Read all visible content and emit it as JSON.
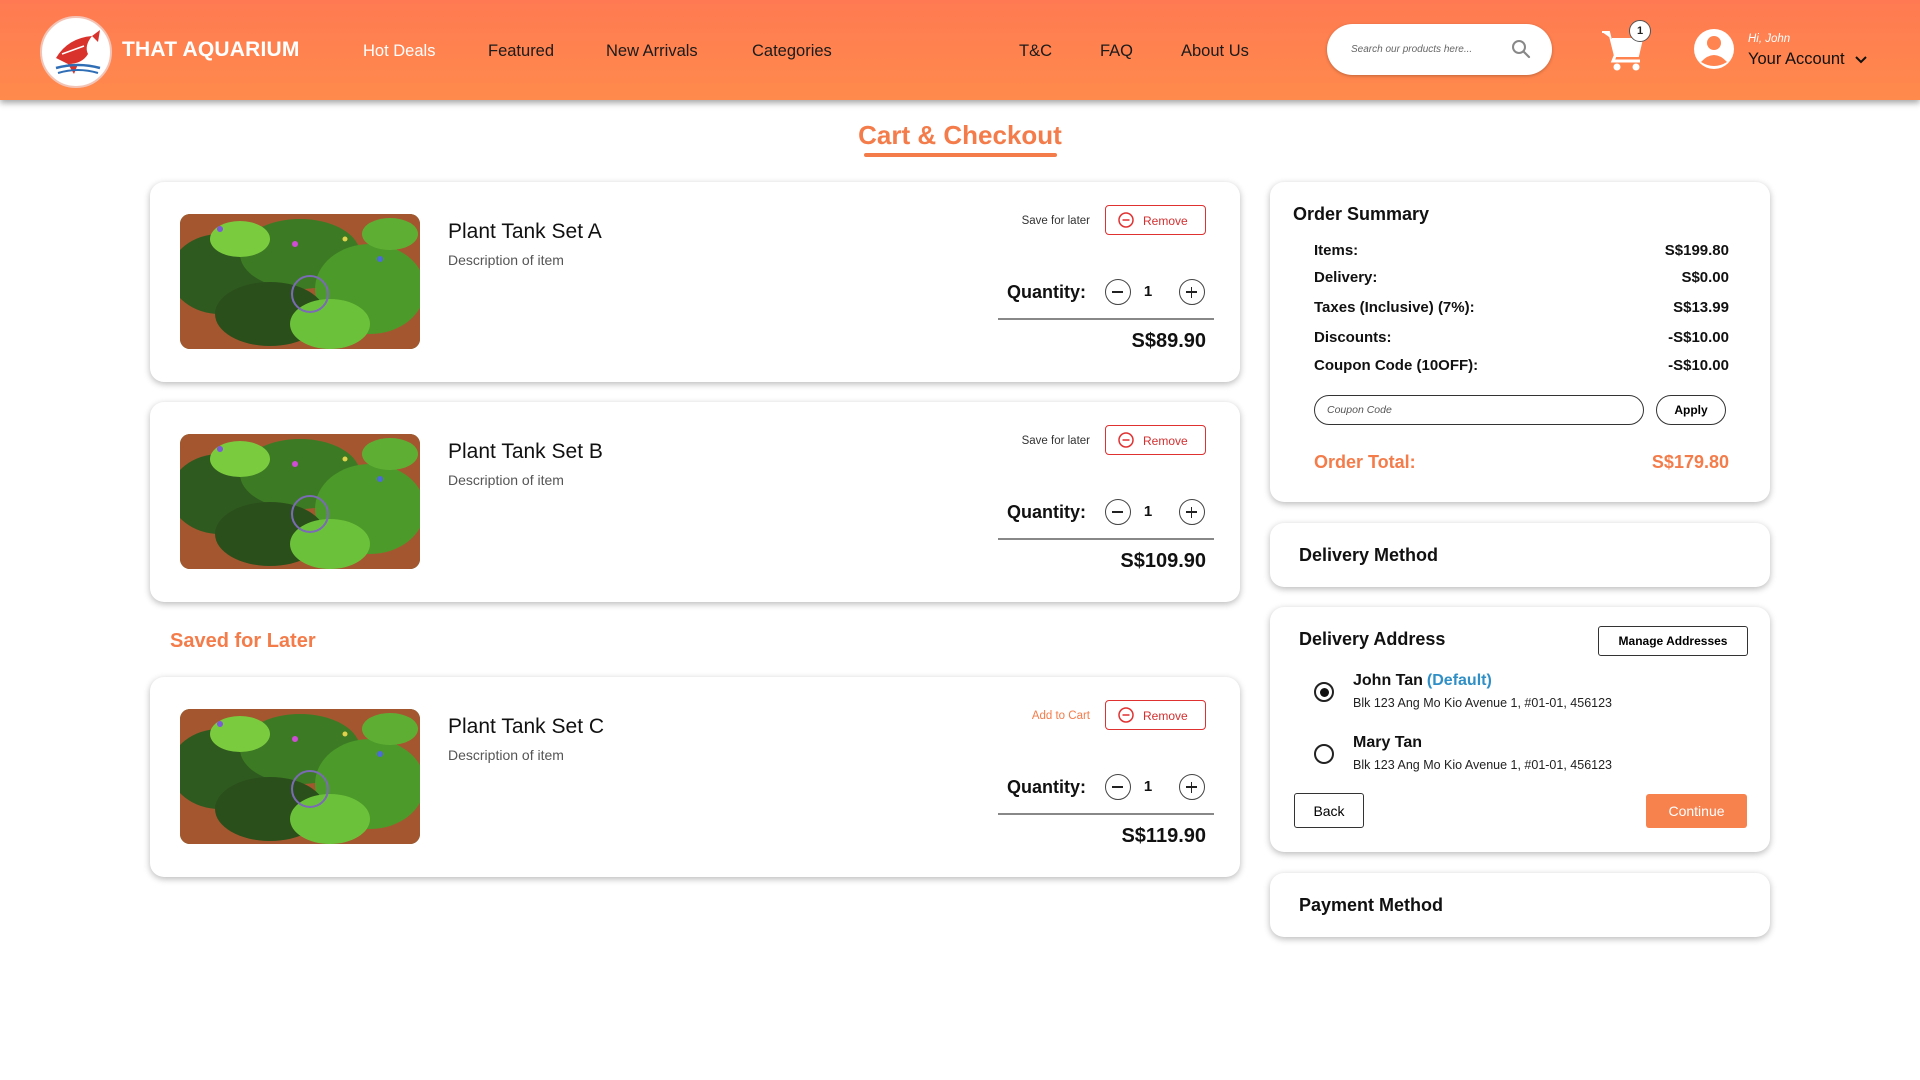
{
  "colors": {
    "brand_orange": "#ff7a52",
    "accent_orange": "#f47c4a",
    "remove_red": "#e03131",
    "default_blue": "#2f8fc6"
  },
  "header": {
    "brand": "THAT AQUARIUM",
    "logo_icon": "angelfish-logo-icon",
    "nav": [
      "Hot Deals",
      "Featured",
      "New Arrivals",
      "Categories",
      "T&C",
      "FAQ",
      "About Us"
    ],
    "search_placeholder": "Search our products here...",
    "cart_count": "1",
    "greeting": "Hi, John",
    "account_label": "Your Account"
  },
  "page": {
    "title": "Cart & Checkout"
  },
  "cart": {
    "items": [
      {
        "name": "Plant Tank Set A",
        "description": "Description of item",
        "action": "Save for later",
        "remove": "Remove",
        "quantity_label": "Quantity:",
        "quantity": "1",
        "price": "S$89.90"
      },
      {
        "name": "Plant Tank Set B",
        "description": "Description of item",
        "action": "Save for later",
        "remove": "Remove",
        "quantity_label": "Quantity:",
        "quantity": "1",
        "price": "S$109.90"
      }
    ],
    "saved_heading": "Saved for Later",
    "saved": [
      {
        "name": "Plant Tank Set C",
        "description": "Description of item",
        "action": "Add to Cart",
        "remove": "Remove",
        "quantity_label": "Quantity:",
        "quantity": "1",
        "price": "S$119.90"
      }
    ]
  },
  "summary": {
    "title": "Order Summary",
    "rows": [
      {
        "label": "Items:",
        "value": "S$199.80"
      },
      {
        "label": "Delivery:",
        "value": "S$0.00"
      },
      {
        "label": "Taxes (Inclusive) (7%):",
        "value": "S$13.99"
      },
      {
        "label": "Discounts:",
        "value": "-S$10.00"
      },
      {
        "label": "Coupon Code (10OFF):",
        "value": "-S$10.00"
      }
    ],
    "coupon_placeholder": "Coupon Code",
    "apply_label": "Apply",
    "total_label": "Order Total:",
    "total_value": "S$179.80"
  },
  "delivery_method": {
    "title": "Delivery Method"
  },
  "delivery_address": {
    "title": "Delivery Address",
    "manage_label": "Manage Addresses",
    "addresses": [
      {
        "name": "John Tan",
        "tag": "(Default)",
        "line": "Blk 123 Ang Mo Kio Avenue 1, #01-01, 456123",
        "selected": true
      },
      {
        "name": "Mary Tan",
        "tag": "",
        "line": "Blk 123 Ang Mo Kio Avenue 1, #01-01, 456123",
        "selected": false
      }
    ],
    "back_label": "Back",
    "continue_label": "Continue"
  },
  "payment_method": {
    "title": "Payment Method"
  }
}
